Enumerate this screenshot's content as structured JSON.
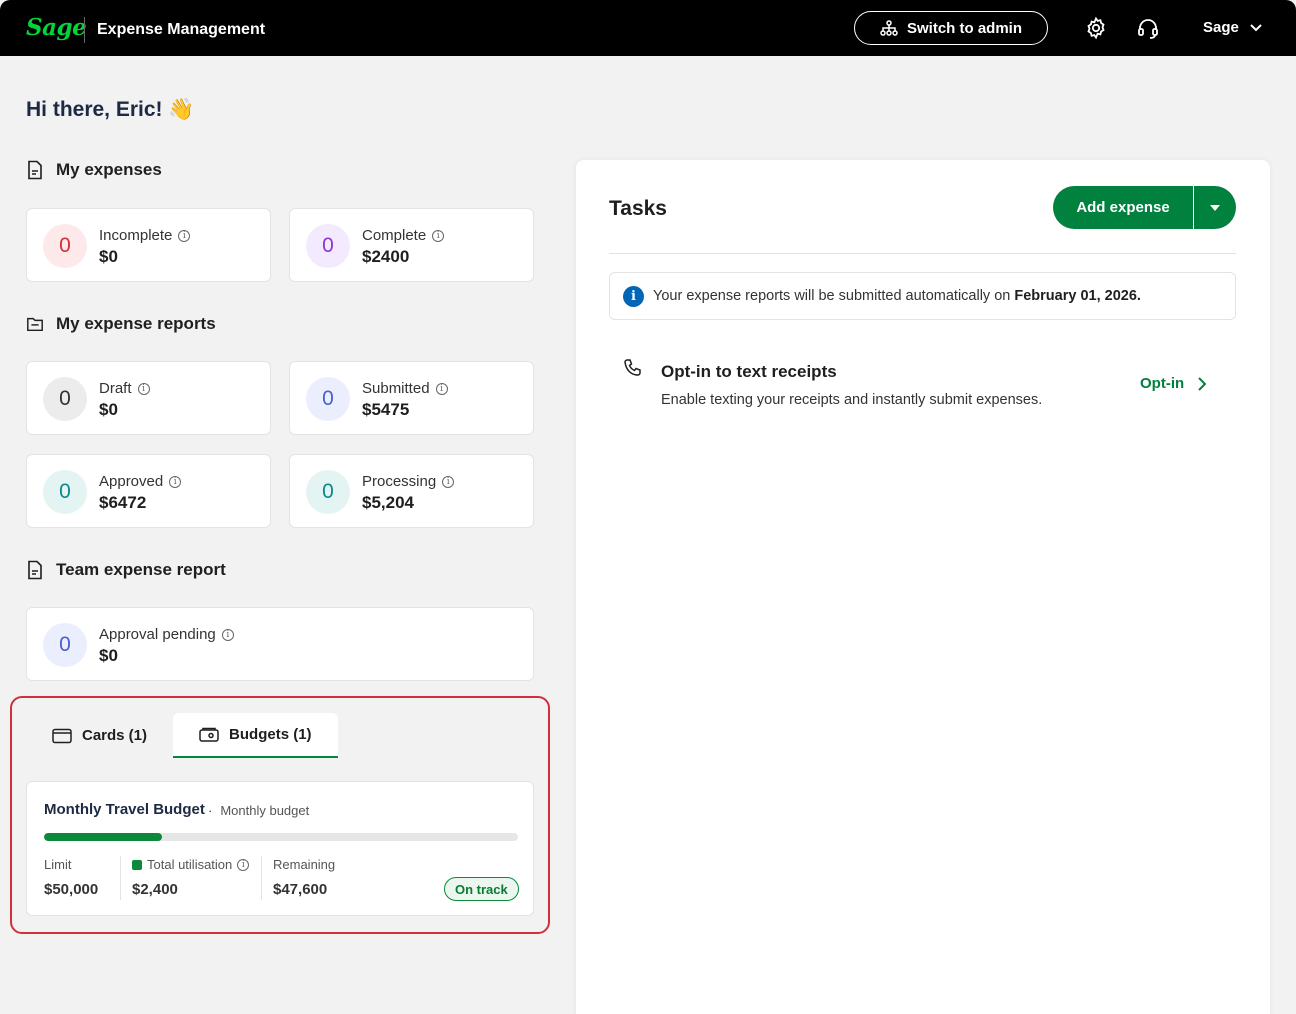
{
  "header": {
    "logo": "Sage",
    "app_title": "Expense Management",
    "switch_label": "Switch to admin",
    "user_label": "Sage"
  },
  "greeting": "Hi there, Eric! 👋",
  "my_expenses": {
    "title": "My expenses",
    "cards": [
      {
        "label": "Incomplete",
        "count": "0",
        "amount": "$0",
        "color": "#d12f3c",
        "bg": "#fde9ea"
      },
      {
        "label": "Complete",
        "count": "0",
        "amount": "$2400",
        "color": "#8d35d6",
        "bg": "#f3eafd"
      }
    ]
  },
  "my_reports": {
    "title": "My expense reports",
    "cards": [
      {
        "label": "Draft",
        "count": "0",
        "amount": "$0",
        "color": "#333333",
        "bg": "#ececec"
      },
      {
        "label": "Submitted",
        "count": "0",
        "amount": "$5475",
        "color": "#4a5fd0",
        "bg": "#ebeefc"
      },
      {
        "label": "Approved",
        "count": "0",
        "amount": "$6472",
        "color": "#0a8a8a",
        "bg": "#e3f4f3"
      },
      {
        "label": "Processing",
        "count": "0",
        "amount": "$5,204",
        "color": "#0a8a8a",
        "bg": "#e3f4f3"
      }
    ]
  },
  "team_report": {
    "title": "Team expense report",
    "cards": [
      {
        "label": "Approval pending",
        "count": "0",
        "amount": "$0",
        "color": "#4a5fd0",
        "bg": "#ebeefc"
      }
    ]
  },
  "tabs": [
    {
      "label": "Cards (1)",
      "active": false
    },
    {
      "label": "Budgets (1)",
      "active": true
    }
  ],
  "budget": {
    "name": "Monthly Travel Budget",
    "type": "Monthly budget",
    "utilisation_fraction": 0.248,
    "limit_label": "Limit",
    "limit_value": "$50,000",
    "used_label": "Total utilisation",
    "used_value": "$2,400",
    "remaining_label": "Remaining",
    "remaining_value": "$47,600",
    "status": "On track"
  },
  "tasks": {
    "title": "Tasks",
    "add_label": "Add expense",
    "notice_text": "Your expense reports will be submitted automatically on ",
    "notice_date": "February 01, 2026.",
    "optin_title": "Opt-in to text receipts",
    "optin_desc": "Enable texting your receipts and instantly submit expenses.",
    "optin_link": "Opt-in"
  }
}
